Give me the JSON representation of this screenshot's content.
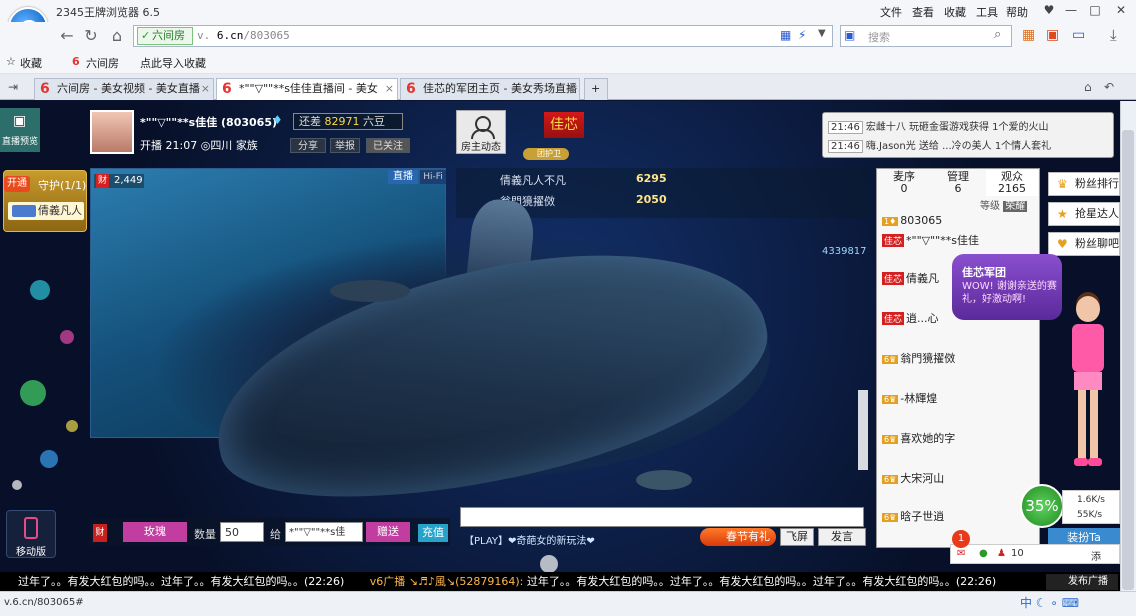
{
  "browser": {
    "app_title": "2345王牌浏览器 6.5",
    "menu": [
      "文件",
      "查看",
      "收藏",
      "工具",
      "帮助"
    ],
    "secure_label": "六间房",
    "url_gray": "v.",
    "url_main": "6.cn",
    "url_path": "/803065",
    "search_placeholder": "搜索",
    "favorites": [
      "收藏",
      "六间房",
      "点此导入收藏"
    ],
    "tabs": [
      {
        "label": "六间房 - 美女视频 - 美女直播",
        "active": false
      },
      {
        "label": "*\"\"▽\"\"**s佳佳直播间 - 美女",
        "active": true
      },
      {
        "label": "佳芯的军团主页 - 美女秀场直播",
        "active": false
      }
    ],
    "status_url": "v.6.cn/803065#"
  },
  "room": {
    "live_preview": "直播预览",
    "guard_open": "开通",
    "guard_title": "守护(1/1)",
    "guard_member": "倩義凡人",
    "mobile_label": "移动版",
    "anchor_name": "*\"\"▽\"\"**s佳佳 (803065)",
    "live_time": "开播 21:07",
    "location": "四川",
    "family": "家族",
    "diff_prefix": "还差",
    "diff_value": "82971",
    "diff_suffix": "六豆",
    "share_btn": "分享",
    "report_btn": "举报",
    "follow_status": "已关注",
    "host_dynamic": "房主动态",
    "flag_name": "佳芯",
    "guard_tag": "团护卫",
    "video_count": "2,449",
    "live_label": "直播",
    "hifi_label": "Hi-Fi",
    "count_num": "4339817"
  },
  "top_messages": [
    {
      "time": "21:46",
      "text": "宏雌十八 玩砸金蛋游戏获得 1个爱的火山"
    },
    {
      "time": "21:46",
      "text": "嗨.Jason光 送给 ...冷の美人 1个情人套礼"
    }
  ],
  "rank": [
    {
      "name": "倩義凡人不凡",
      "value": "6295"
    },
    {
      "name": "翁門獍擢傚",
      "value": "2050"
    }
  ],
  "gift_bar": {
    "wealth": "财",
    "rose": "玫瑰",
    "qty_label": "数量",
    "qty_value": "50",
    "to_label": "给",
    "to_value": "*\"\"▽\"\"**s佳",
    "send": "赠送",
    "recharge": "充值"
  },
  "chat": {
    "play_msg": "【PLAY】❤奇葩女的新玩法❤",
    "spring_btn": "春节有礼",
    "fly_btn": "飞屏",
    "send_btn": "发言"
  },
  "users": {
    "tabs": [
      {
        "label": "麦序",
        "count": "0"
      },
      {
        "label": "管理",
        "count": "6"
      },
      {
        "label": "观众",
        "count": "2165"
      }
    ],
    "level_label": "等级",
    "level_btn": "荣耀",
    "rows": [
      {
        "text": "803065",
        "tag": ""
      },
      {
        "text": "*\"\"▽\"\"**s佳佳",
        "tag": "佳芯"
      },
      {
        "text": "倩義凡",
        "tag": "佳芯"
      },
      {
        "text": "逍...心",
        "tag": "佳芯"
      },
      {
        "text": "翁門獍擢傚",
        "tag": ""
      },
      {
        "text": "-林輝煌",
        "tag": ""
      },
      {
        "text": "喜欢她的字",
        "tag": ""
      },
      {
        "text": "大宋河山",
        "tag": ""
      },
      {
        "text": "晗子世逍",
        "tag": ""
      }
    ]
  },
  "fans": [
    {
      "label": "粉丝排行",
      "icon": "crown-icon"
    },
    {
      "label": "抢星达人",
      "icon": "star-icon"
    },
    {
      "label": "粉丝聊吧",
      "icon": "heart-icon"
    }
  ],
  "army": {
    "title": "佳芯军团",
    "text": "WOW! 谢谢亲送的赛礼，好激动啊!"
  },
  "speed": {
    "percent": "35%",
    "up": "1.6K/s",
    "down": "55K/s"
  },
  "follow_btn": "装扮Ta",
  "notif": {
    "badge": "1",
    "count": "10",
    "extra": "添"
  },
  "ticker": {
    "text1": "过年了。。有发大红包的吗。。过年了。。有发大红包的吗。。(22:26)",
    "user": "v6广播 ↘♬♪風↘(52879164):",
    "text2": "过年了。。有发大红包的吗。。过年了。。有发大红包的吗。。过年了。。有发大红包的吗。。(22:26)",
    "btn": "发布广播"
  },
  "colors": {
    "accent": "#c23da0",
    "brand_red": "#e3342f",
    "green": "#1f8a1f"
  }
}
